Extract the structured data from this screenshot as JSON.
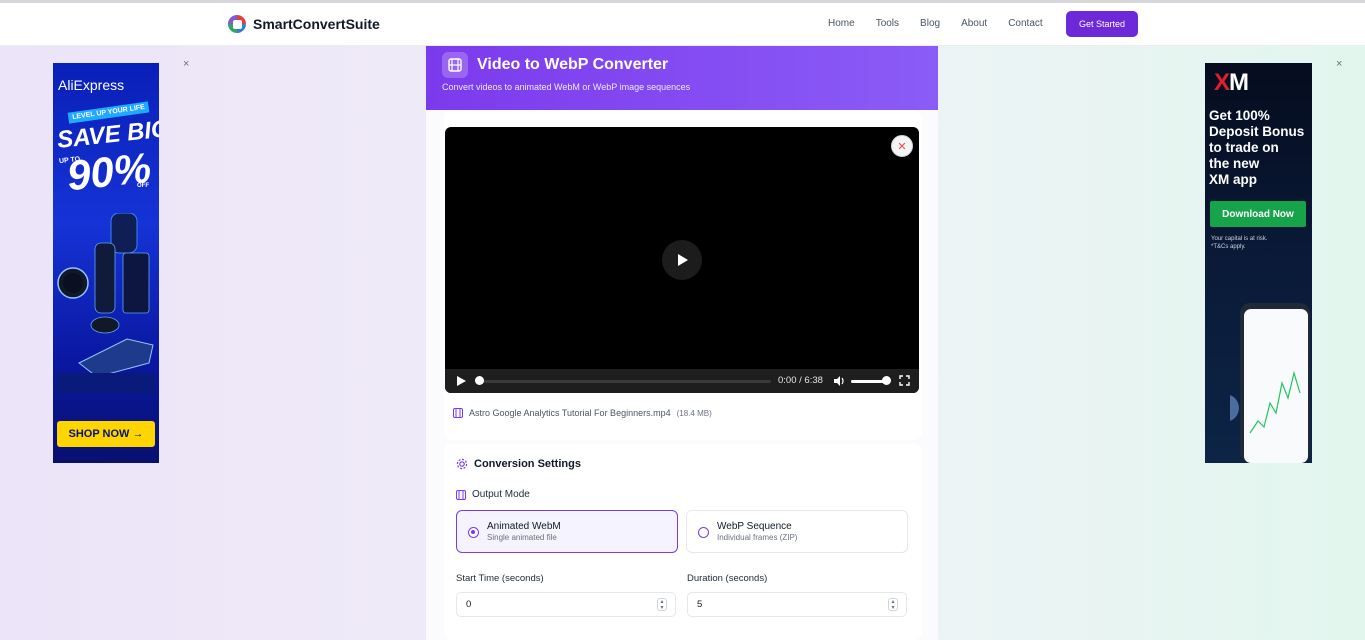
{
  "brand": {
    "name": "SmartConvertSuite"
  },
  "nav": {
    "links": [
      "Home",
      "Tools",
      "Blog",
      "About",
      "Contact"
    ],
    "cta_label": "Get Started"
  },
  "ads": {
    "left": {
      "brand": "AliExpress",
      "ribbon": "LEVEL UP YOUR LIFE",
      "headline": "SAVE BIG",
      "upto": "UP TO",
      "percent": "90%",
      "off": "OFF",
      "cta": "SHOP NOW →",
      "close": "×"
    },
    "right": {
      "logo_x": "X",
      "logo_m": "M",
      "headline_lines": [
        "Get 100%",
        "Deposit Bonus",
        "to trade on",
        "the new",
        "XM app"
      ],
      "cta": "Download Now",
      "risk_line1": "Your capital is at risk.",
      "risk_line2": "*T&Cs apply.",
      "close": "×"
    }
  },
  "converter": {
    "title": "Video to WebP Converter",
    "subtitle": "Convert videos to animated WebM or WebP image sequences",
    "player": {
      "time_current": "0:00",
      "time_total": "6:38",
      "time_display": "0:00 / 6:38",
      "progress": 0.0,
      "volume": 1.0
    },
    "file": {
      "name": "Astro Google Analytics Tutorial For Beginners.mp4",
      "size": "(18.4 MB)"
    },
    "settings": {
      "title": "Conversion Settings",
      "output_mode_label": "Output Mode",
      "options": [
        {
          "title": "Animated WebM",
          "subtitle": "Single animated file",
          "selected": true
        },
        {
          "title": "WebP Sequence",
          "subtitle": "Individual frames (ZIP)",
          "selected": false
        }
      ],
      "start_time_label": "Start Time (seconds)",
      "start_time_value": "0",
      "duration_label": "Duration (seconds)",
      "duration_value": "5"
    }
  },
  "colors": {
    "accent": "#7c3aed",
    "cta": "#6d28d9",
    "ad_left_bg": "#1533d6",
    "ad_right_bg": "#0a1a38",
    "xm_red": "#e11d2e",
    "xm_green": "#16a34a"
  }
}
